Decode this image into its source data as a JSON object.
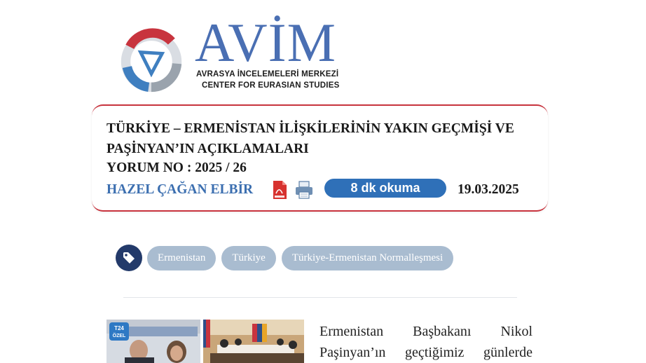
{
  "header": {
    "brand": "AVİM",
    "subtitle_tr": "AVRASYA İNCELEMELERİ MERKEZİ",
    "subtitle_en": "CENTER FOR EURASIAN STUDIES"
  },
  "article": {
    "title": "TÜRKİYE – ERMENİSTAN İLİŞKİLERİNİN YAKIN GEÇMİŞİ VE PAŞİNYAN’IN AÇIKLAMALARI",
    "yorum": "YORUM NO : 2025 / 26",
    "author": "HAZEL ÇAĞAN ELBİR",
    "reading_time": "8 dk okuma",
    "date": "19.03.2025",
    "pdf_icon": "pdf-icon",
    "print_icon": "printer-icon"
  },
  "tags": {
    "icon": "tag-icon",
    "items": [
      "Ermenistan",
      "Türkiye",
      "Türkiye-Ermenistan Normalleşmesi"
    ]
  },
  "content": {
    "photo_badge_line1": "T24",
    "photo_badge_line2": "ÖZEL",
    "intro_line1": "Ermenistan Başbakanı Nikol",
    "intro_line2": "Paşinyan’ın geçtiğimiz günlerde"
  },
  "colors": {
    "brand_blue": "#4a6fb3",
    "accent_red": "#c8343e",
    "author_blue": "#3c6fb0",
    "pill_blue": "#2f70b8",
    "tag_bg": "#a9bcd0",
    "tag_icon_bg": "#233a6a"
  }
}
